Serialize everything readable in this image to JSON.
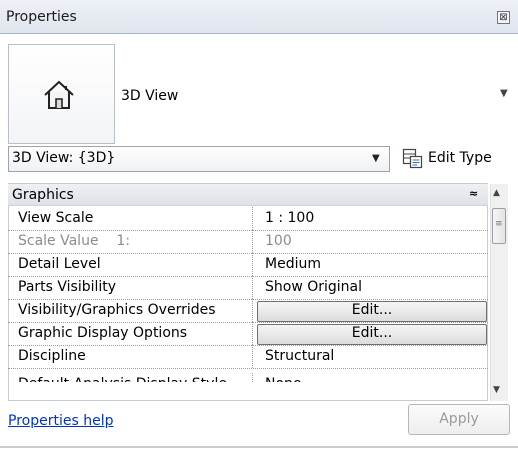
{
  "panel": {
    "title": "Properties",
    "close_glyph": "⊠"
  },
  "type_selector": {
    "icon": "house-icon",
    "type_name": "3D View",
    "dropdown_glyph": "▼"
  },
  "instance": {
    "selected": "3D View: {3D}",
    "dropdown_glyph": "▼",
    "edit_type_label": "Edit Type",
    "edit_type_icon": "edit-type-icon"
  },
  "group": {
    "name": "Graphics",
    "collapse_glyph": "≈"
  },
  "properties": [
    {
      "name": "View Scale",
      "value": "1 : 100",
      "kind": "text",
      "dim": false
    },
    {
      "name": "Scale Value    1:",
      "value": "100",
      "kind": "text",
      "dim": true
    },
    {
      "name": "Detail Level",
      "value": "Medium",
      "kind": "text",
      "dim": false
    },
    {
      "name": "Parts Visibility",
      "value": "Show Original",
      "kind": "text",
      "dim": false
    },
    {
      "name": "Visibility/Graphics Overrides",
      "value": "Edit...",
      "kind": "button",
      "dim": false
    },
    {
      "name": "Graphic Display Options",
      "value": "Edit...",
      "kind": "button",
      "dim": false
    },
    {
      "name": "Discipline",
      "value": "Structural",
      "kind": "text",
      "dim": false
    },
    {
      "name": "Default Analysis Display Style",
      "value": "None",
      "kind": "text",
      "dim": false
    }
  ],
  "scrollbar": {
    "up_glyph": "▲",
    "down_glyph": "▼",
    "grip_glyph": "≡"
  },
  "footer": {
    "help_link": "Properties help",
    "apply_label": "Apply"
  }
}
